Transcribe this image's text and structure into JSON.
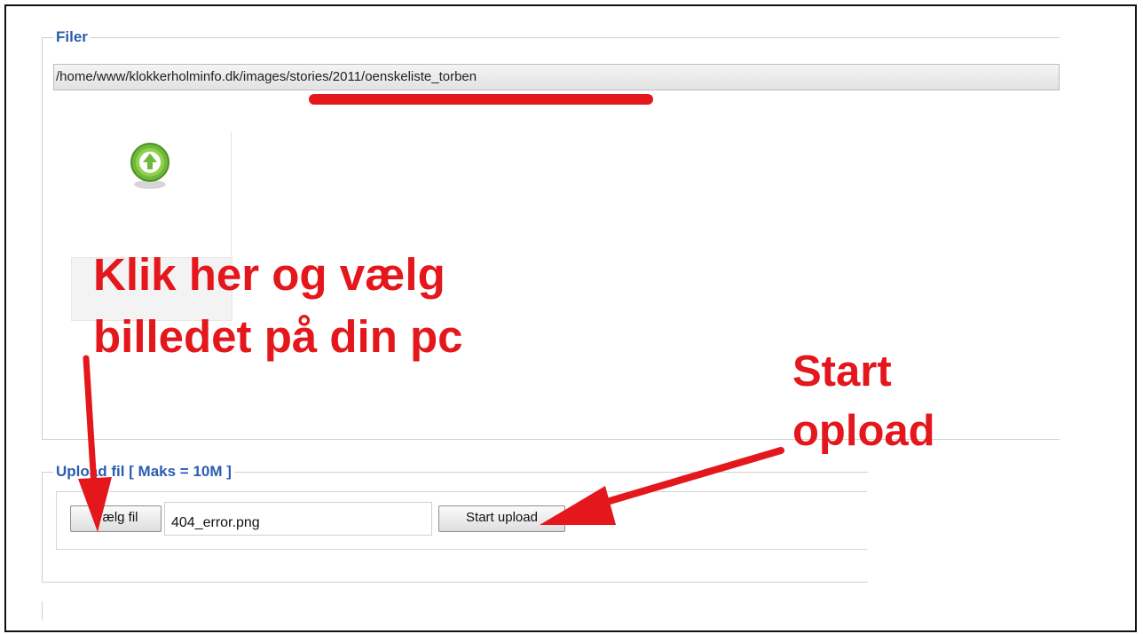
{
  "filer": {
    "legend": "Filer",
    "path": "/home/www/klokkerholminfo.dk/images/stories/2011/oenskeliste_torben"
  },
  "upload": {
    "legend": "Upload fil [ Maks = 10M ]",
    "choose_label": "Vælg fil",
    "file_name": "404_error.png",
    "start_label": "Start upload"
  },
  "annotations": {
    "choose_line1": "Klik her og vælg",
    "choose_line2": "billedet på din pc",
    "start_line1": "Start",
    "start_line2": "opload"
  },
  "colors": {
    "annotation": "#e3171c",
    "legend": "#2a5db0",
    "icon": "#7cc242"
  },
  "icons": {
    "up": "upload-arrow-icon"
  }
}
